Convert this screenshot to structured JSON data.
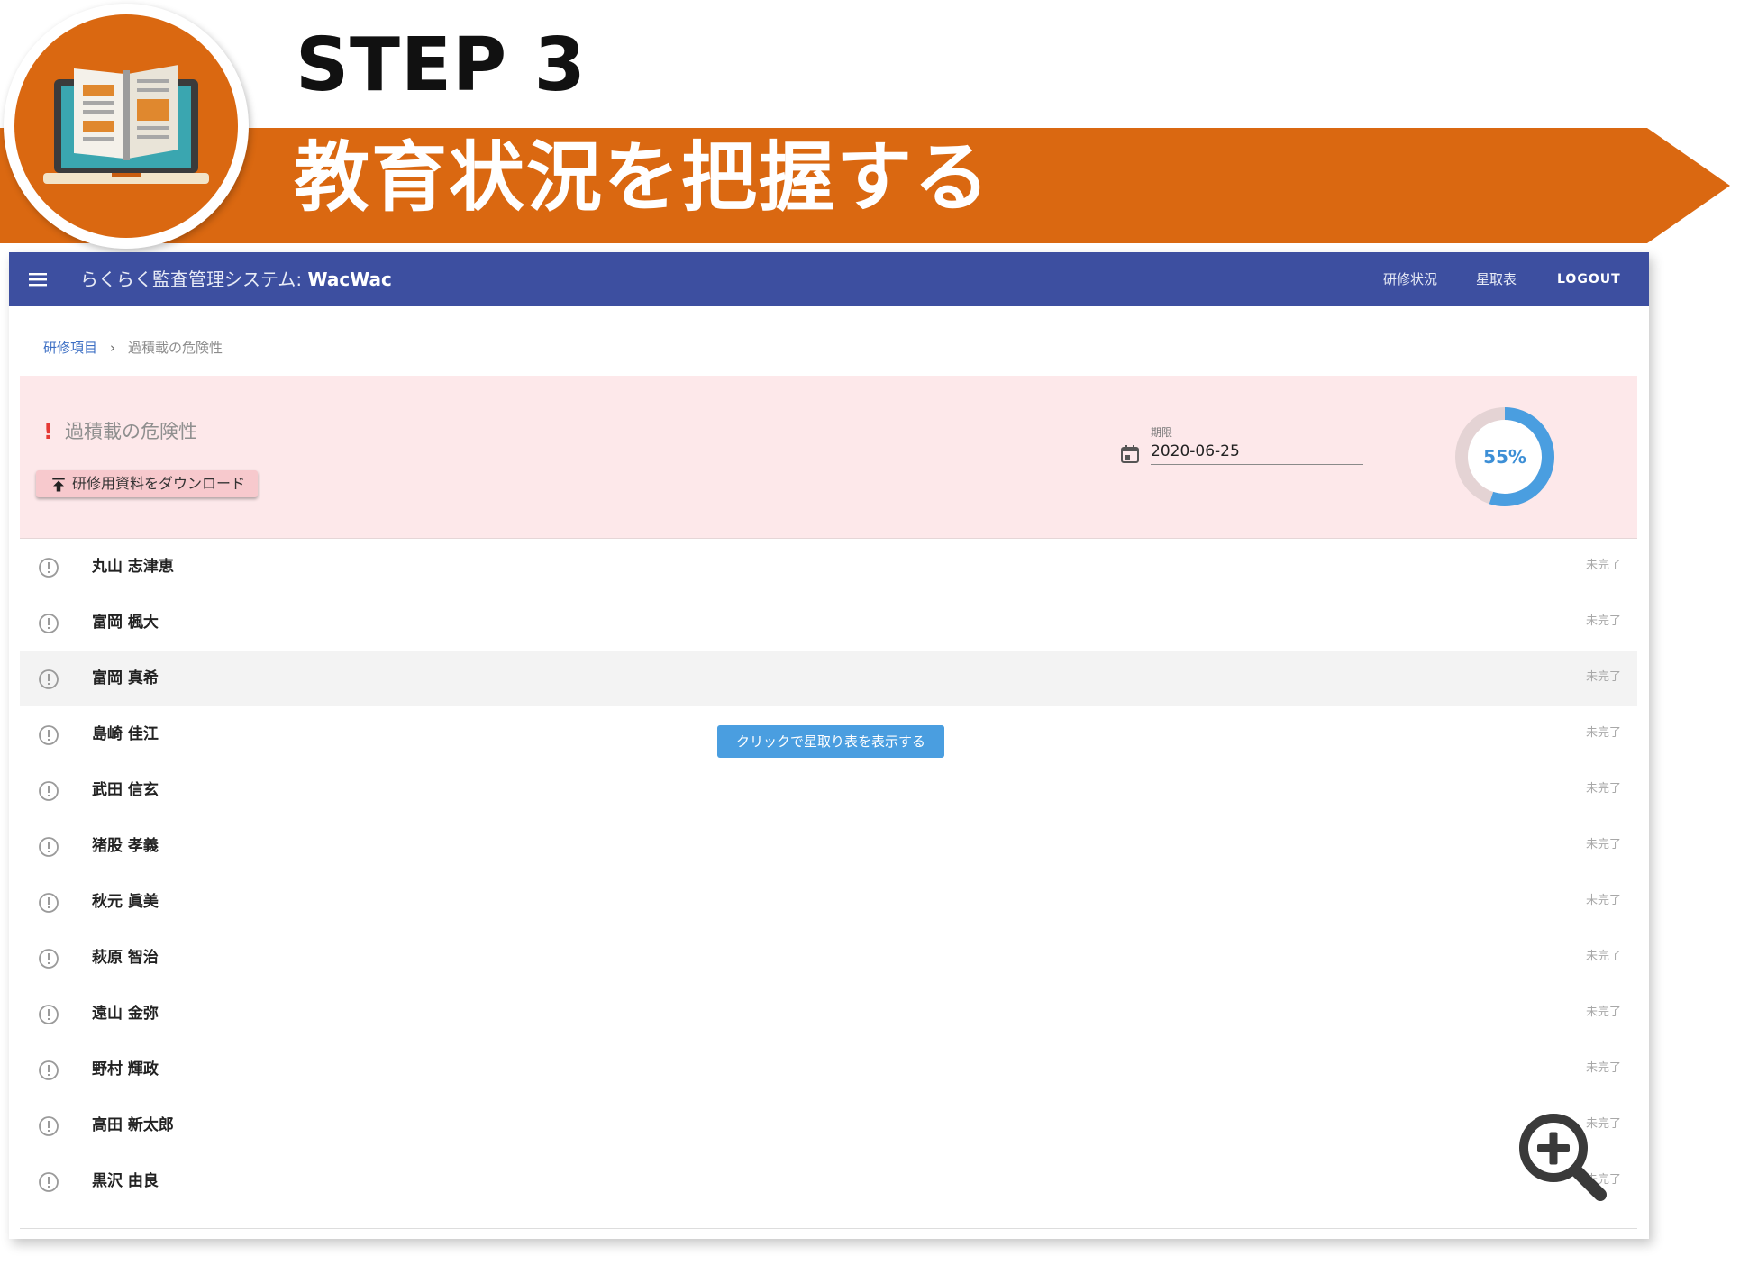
{
  "step": {
    "label": "STEP 3",
    "title": "教育状況を把握する"
  },
  "app": {
    "title_prefix": "らくらく監査管理システム: ",
    "title_brand": "WacWac",
    "nav": {
      "status": "研修状況",
      "star_table": "星取表",
      "logout": "LOGOUT"
    }
  },
  "breadcrumb": {
    "root": "研修項目",
    "separator": "›",
    "current": "過積載の危険性"
  },
  "course": {
    "alert": "!",
    "title": "過積載の危険性",
    "download_label": "研修用資料をダウンロード",
    "deadline_label": "期限",
    "deadline_value": "2020-06-25",
    "progress_percent": 55,
    "progress_text": "55%"
  },
  "trainees": [
    {
      "name": "丸山 志津恵",
      "status": "未完了"
    },
    {
      "name": "富岡 楓大",
      "status": "未完了"
    },
    {
      "name": "富岡 真希",
      "status": "未完了"
    },
    {
      "name": "島崎 佳江",
      "status": "未完了"
    },
    {
      "name": "武田 信玄",
      "status": "未完了"
    },
    {
      "name": "猪股 孝義",
      "status": "未完了"
    },
    {
      "name": "秋元 眞美",
      "status": "未完了"
    },
    {
      "name": "萩原 智治",
      "status": "未完了"
    },
    {
      "name": "遠山 金弥",
      "status": "未完了"
    },
    {
      "name": "野村 輝政",
      "status": "未完了"
    },
    {
      "name": "高田 新太郎",
      "status": "未完了"
    },
    {
      "name": "黒沢 由良",
      "status": "未完了"
    }
  ],
  "tooltip": "クリックで星取り表を表示する",
  "colors": {
    "brand_orange": "#da6811",
    "appbar": "#3d4fa0",
    "card_bg": "#fde8ea",
    "progress": "#4a9ee0",
    "progress_track": "#e4d3d4"
  },
  "icons": [
    "book-laptop-icon",
    "menu-icon",
    "upload-icon",
    "calendar-icon",
    "alert-circle-icon",
    "zoom-in-icon"
  ]
}
